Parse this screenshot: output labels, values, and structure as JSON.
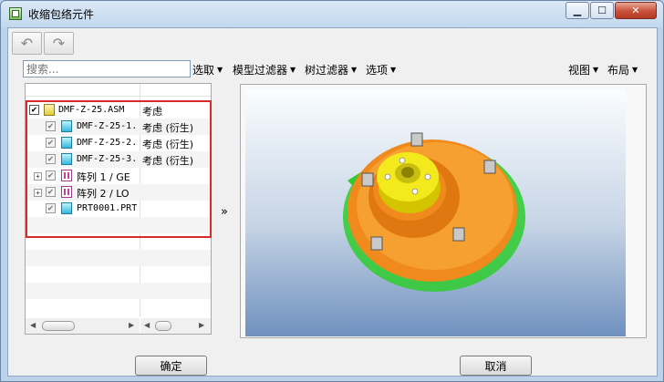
{
  "window": {
    "title": "收缩包络元件"
  },
  "toolbar": {
    "undo_icon": "undo-icon",
    "redo_icon": "redo-icon"
  },
  "search": {
    "placeholder": "搜索..."
  },
  "menus": {
    "select": "选取",
    "model_filter": "模型过滤器",
    "tree_filter": "树过滤器",
    "options": "选项",
    "view": "视图",
    "layout": "布局"
  },
  "tree": {
    "rows": [
      {
        "name": "DMF-Z-25.ASM",
        "status": "考虑",
        "icon": "assembly-icon",
        "checked": true
      },
      {
        "name": "DMF-Z-25-1.",
        "status": "考虑 (衍生)",
        "icon": "part-icon",
        "checked": true
      },
      {
        "name": "DMF-Z-25-2.",
        "status": "考虑 (衍生)",
        "icon": "part-icon",
        "checked": true
      },
      {
        "name": "DMF-Z-25-3.",
        "status": "考虑 (衍生)",
        "icon": "part-icon",
        "checked": true
      },
      {
        "name": "阵列 1 / GE",
        "status": "",
        "icon": "pattern-icon",
        "checked": true
      },
      {
        "name": "阵列 2 / LO",
        "status": "",
        "icon": "pattern-icon",
        "checked": true
      },
      {
        "name": "PRT0001.PRT",
        "status": "",
        "icon": "part-icon",
        "checked": true
      }
    ]
  },
  "expand_button": "»",
  "buttons": {
    "ok": "确定",
    "cancel": "取消"
  },
  "colors": {
    "accent_highlight": "#d92a2a",
    "model_orange": "#f08a1c",
    "model_yellow": "#f2ea1c",
    "model_green": "#2ecc2e"
  }
}
